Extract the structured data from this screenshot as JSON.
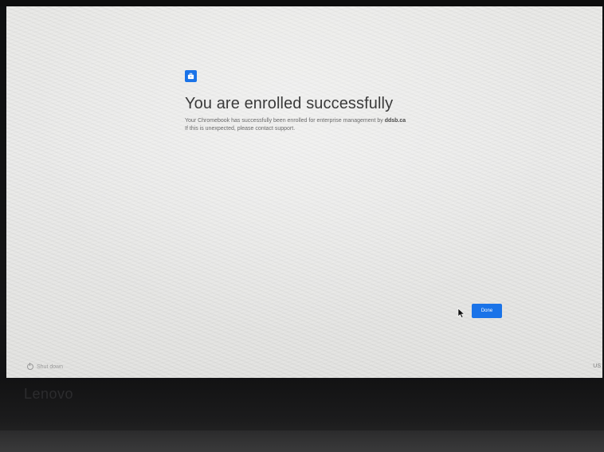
{
  "screen": {
    "title": "You are enrolled successfully",
    "message_line_1": "Your Chromebook has successfully been enrolled for enterprise management by",
    "message_domain": "ddsb.ca",
    "message_line_2": "If this is unexpected, please contact support.",
    "done_label": "Done",
    "shutdown_label": "Shut down",
    "locale_label": "US",
    "accent_color": "#1a73e8"
  },
  "device": {
    "brand_logo": "Lenovo"
  },
  "icons": {
    "enrollment": "briefcase-icon",
    "shutdown": "power-icon",
    "pointer": "mouse-cursor-icon"
  }
}
